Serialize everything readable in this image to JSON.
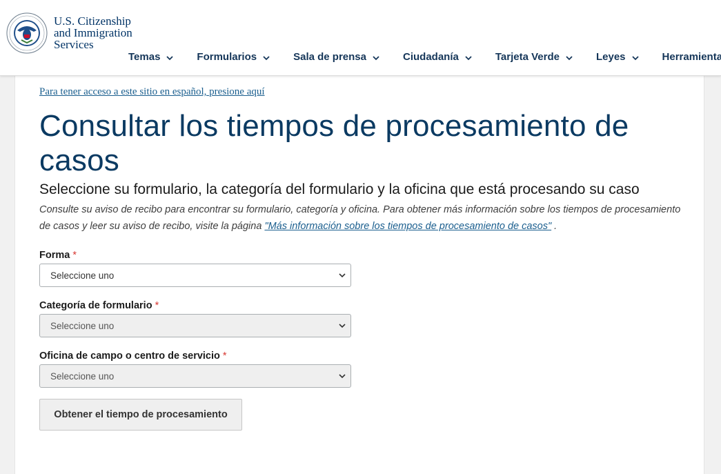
{
  "header": {
    "agency_lines": [
      "U.S. Citizenship",
      "and Immigration",
      "Services"
    ],
    "nav": [
      {
        "label": "Temas"
      },
      {
        "label": "Formularios"
      },
      {
        "label": "Sala de prensa"
      },
      {
        "label": "Ciudadanía"
      },
      {
        "label": "Tarjeta Verde"
      },
      {
        "label": "Leyes"
      },
      {
        "label": "Herramientas"
      }
    ]
  },
  "main": {
    "spanish_link": "Para tener acceso a este sitio en español, presione aquí",
    "title": "Consultar los tiempos de procesamiento de casos",
    "subtitle": "Seleccione su formulario, la categoría del formulario y la oficina que está procesando su caso",
    "help_prefix": "Consulte su aviso de recibo para encontrar su formulario, categoría y oficina. Para obtener más información sobre los tiempos de procesamiento de casos y leer su aviso de recibo, visite la página ",
    "help_link": "\"Más información sobre los tiempos de procesamiento de casos\"",
    "help_suffix": " .",
    "required_mark": "*",
    "fields": [
      {
        "label": "Forma",
        "value": "Seleccione uno",
        "disabled": false
      },
      {
        "label": "Categoría de formulario",
        "value": "Seleccione uno",
        "disabled": true
      },
      {
        "label": "Oficina de campo o centro de servicio",
        "value": "Seleccione uno",
        "disabled": true
      }
    ],
    "submit_label": "Obtener el tiempo de procesamiento"
  },
  "colors": {
    "title": "#0b3a62",
    "nav": "#153659",
    "link": "#1a5e8e",
    "required": "#d83933"
  }
}
